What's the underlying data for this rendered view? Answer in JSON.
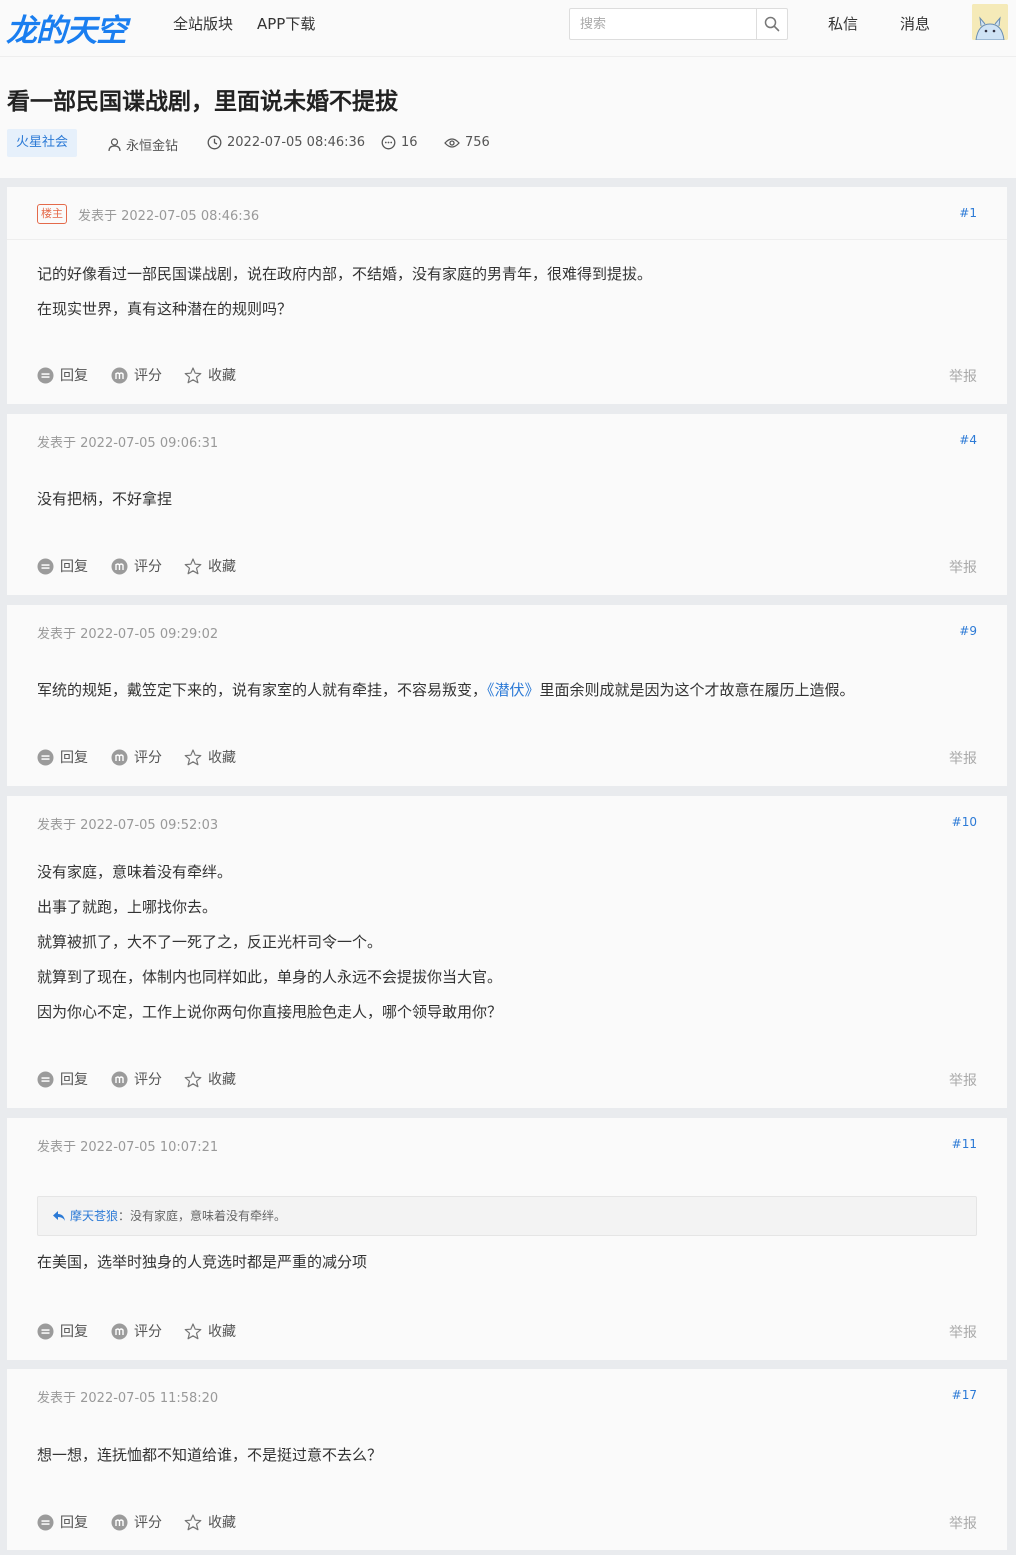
{
  "site": {
    "logo_text": "龙的天空",
    "nav": [
      "全站版块",
      "APP下载"
    ],
    "search_placeholder": "搜索",
    "right_links": [
      "私信",
      "消息"
    ]
  },
  "thread": {
    "title": "看一部民国谍战剧，里面说未婚不提拔",
    "forum": "火星社会",
    "author": "永恒金钻",
    "datetime": "2022-07-05 08:46:36",
    "replies": "16",
    "views": "756"
  },
  "labels": {
    "op_badge": "楼主",
    "reply": "回复",
    "rate": "评分",
    "favorite": "收藏",
    "report": "举报"
  },
  "posts": [
    {
      "time": "发表于 2022-07-05 08:46:36",
      "floor": "#1",
      "lines": [
        "记的好像看过一部民国谍战剧，说在政府内部，不结婚，没有家庭的男青年，很难得到提拔。",
        "在现实世界，真有这种潜在的规则吗？"
      ]
    },
    {
      "time": "发表于 2022-07-05 09:06:31",
      "floor": "#4",
      "lines": [
        "没有把柄，不好拿捏"
      ]
    },
    {
      "time": "发表于 2022-07-05 09:29:02",
      "floor": "#9",
      "line_a": "军统的规矩，戴笠定下来的，说有家室的人就有牵挂，不容易叛变，",
      "line_link": "《潜伏》",
      "line_b": "里面余则成就是因为这个才故意在履历上造假。"
    },
    {
      "time": "发表于 2022-07-05 09:52:03",
      "floor": "#10",
      "lines": [
        "没有家庭，意味着没有牵绊。",
        "出事了就跑，上哪找你去。",
        "就算被抓了，大不了一死了之，反正光杆司令一个。",
        "就算到了现在，体制内也同样如此，单身的人永远不会提拔你当大官。",
        "因为你心不定，工作上说你两句你直接甩脸色走人，哪个领导敢用你？"
      ]
    },
    {
      "time": "发表于 2022-07-05 10:07:21",
      "floor": "#11",
      "quote_user": "摩天苍狼",
      "quote_text": "：没有家庭，意味着没有牵绊。",
      "lines": [
        "在美国，选举时独身的人竞选时都是严重的减分项"
      ]
    },
    {
      "time": "发表于 2022-07-05 11:58:20",
      "floor": "#17",
      "lines": [
        "想一想，连抚恤都不知道给谁，不是挺过意不去么？"
      ]
    }
  ]
}
